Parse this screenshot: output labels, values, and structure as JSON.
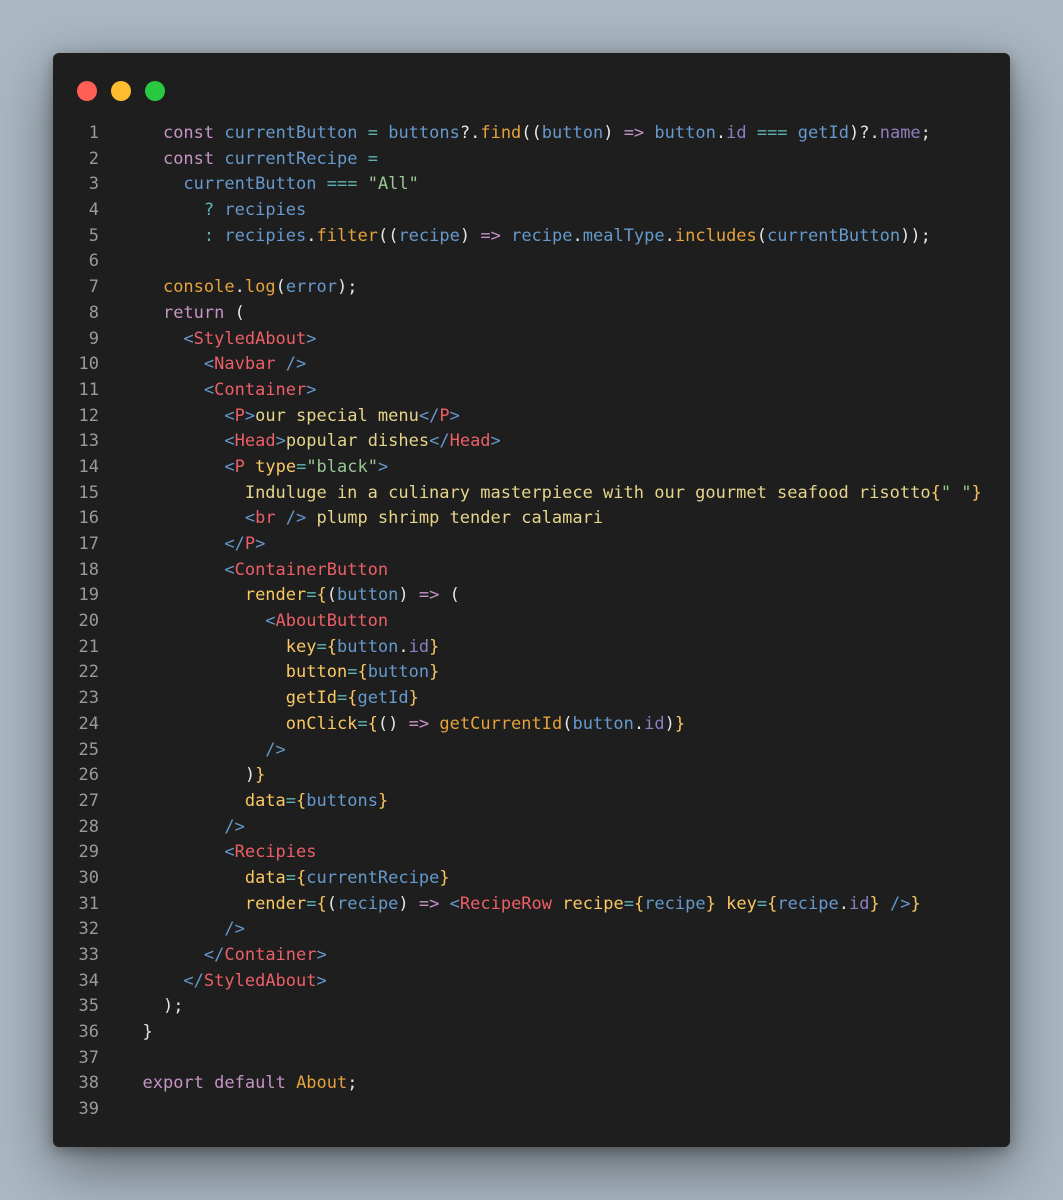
{
  "window": {
    "background": "#1e1e1e",
    "traffic_lights": [
      {
        "name": "close",
        "color": "#ff5f57"
      },
      {
        "name": "minimize",
        "color": "#febc2e"
      },
      {
        "name": "zoom",
        "color": "#28c840"
      }
    ]
  },
  "palette": {
    "k": "#c594c5",
    "v": "#6699cc",
    "f": "#e5a23c",
    "t": "#ec5f67",
    "a": "#fac863",
    "s": "#99c794",
    "o": "#5fb3b3",
    "x": "#e5d48a",
    "p": "#e5e5e5",
    "i": "#8f7ebd"
  },
  "code": {
    "lines": [
      {
        "n": "1",
        "tokens": [
          [
            "    ",
            "p"
          ],
          [
            "const",
            "k"
          ],
          [
            " ",
            "p"
          ],
          [
            "currentButton",
            "v"
          ],
          [
            " ",
            "p"
          ],
          [
            "=",
            "o"
          ],
          [
            " ",
            "p"
          ],
          [
            "buttons",
            "v"
          ],
          [
            "?.",
            "p"
          ],
          [
            "find",
            "f"
          ],
          [
            "((",
            "p"
          ],
          [
            "button",
            "v"
          ],
          [
            ") ",
            "p"
          ],
          [
            "=>",
            "k"
          ],
          [
            " ",
            "p"
          ],
          [
            "button",
            "v"
          ],
          [
            ".",
            "p"
          ],
          [
            "id",
            "i"
          ],
          [
            " ",
            "p"
          ],
          [
            "===",
            "o"
          ],
          [
            " ",
            "p"
          ],
          [
            "getId",
            "v"
          ],
          [
            ")",
            "p"
          ],
          [
            "?.",
            "p"
          ],
          [
            "name",
            "i"
          ],
          [
            ";",
            "p"
          ]
        ]
      },
      {
        "n": "2",
        "tokens": [
          [
            "    ",
            "p"
          ],
          [
            "const",
            "k"
          ],
          [
            " ",
            "p"
          ],
          [
            "currentRecipe",
            "v"
          ],
          [
            " ",
            "p"
          ],
          [
            "=",
            "o"
          ]
        ]
      },
      {
        "n": "3",
        "tokens": [
          [
            "      ",
            "p"
          ],
          [
            "currentButton",
            "v"
          ],
          [
            " ",
            "p"
          ],
          [
            "===",
            "o"
          ],
          [
            " ",
            "p"
          ],
          [
            "\"All\"",
            "s"
          ]
        ]
      },
      {
        "n": "4",
        "tokens": [
          [
            "        ",
            "p"
          ],
          [
            "?",
            "o"
          ],
          [
            " ",
            "p"
          ],
          [
            "recipies",
            "v"
          ]
        ]
      },
      {
        "n": "5",
        "tokens": [
          [
            "        ",
            "p"
          ],
          [
            ":",
            "o"
          ],
          [
            " ",
            "p"
          ],
          [
            "recipies",
            "v"
          ],
          [
            ".",
            "p"
          ],
          [
            "filter",
            "f"
          ],
          [
            "((",
            "p"
          ],
          [
            "recipe",
            "v"
          ],
          [
            ") ",
            "p"
          ],
          [
            "=>",
            "k"
          ],
          [
            " ",
            "p"
          ],
          [
            "recipe",
            "v"
          ],
          [
            ".",
            "p"
          ],
          [
            "mealType",
            "v"
          ],
          [
            ".",
            "p"
          ],
          [
            "includes",
            "f"
          ],
          [
            "(",
            "p"
          ],
          [
            "currentButton",
            "v"
          ],
          [
            "));",
            "p"
          ]
        ]
      },
      {
        "n": "6",
        "tokens": []
      },
      {
        "n": "7",
        "tokens": [
          [
            "    ",
            "p"
          ],
          [
            "console",
            "f"
          ],
          [
            ".",
            "p"
          ],
          [
            "log",
            "f"
          ],
          [
            "(",
            "p"
          ],
          [
            "error",
            "v"
          ],
          [
            ");",
            "p"
          ]
        ]
      },
      {
        "n": "8",
        "tokens": [
          [
            "    ",
            "p"
          ],
          [
            "return",
            "k"
          ],
          [
            " (",
            "p"
          ]
        ]
      },
      {
        "n": "9",
        "tokens": [
          [
            "      ",
            "p"
          ],
          [
            "<",
            "v"
          ],
          [
            "StyledAbout",
            "t"
          ],
          [
            ">",
            "v"
          ]
        ]
      },
      {
        "n": "10",
        "tokens": [
          [
            "        ",
            "p"
          ],
          [
            "<",
            "v"
          ],
          [
            "Navbar",
            "t"
          ],
          [
            " />",
            "v"
          ]
        ]
      },
      {
        "n": "11",
        "tokens": [
          [
            "        ",
            "p"
          ],
          [
            "<",
            "v"
          ],
          [
            "Container",
            "t"
          ],
          [
            ">",
            "v"
          ]
        ]
      },
      {
        "n": "12",
        "tokens": [
          [
            "          ",
            "p"
          ],
          [
            "<",
            "v"
          ],
          [
            "P",
            "t"
          ],
          [
            ">",
            "v"
          ],
          [
            "our special menu",
            "x"
          ],
          [
            "</",
            "v"
          ],
          [
            "P",
            "t"
          ],
          [
            ">",
            "v"
          ]
        ]
      },
      {
        "n": "13",
        "tokens": [
          [
            "          ",
            "p"
          ],
          [
            "<",
            "v"
          ],
          [
            "Head",
            "t"
          ],
          [
            ">",
            "v"
          ],
          [
            "popular dishes",
            "x"
          ],
          [
            "</",
            "v"
          ],
          [
            "Head",
            "t"
          ],
          [
            ">",
            "v"
          ]
        ]
      },
      {
        "n": "14",
        "tokens": [
          [
            "          ",
            "p"
          ],
          [
            "<",
            "v"
          ],
          [
            "P",
            "t"
          ],
          [
            " ",
            "p"
          ],
          [
            "type",
            "a"
          ],
          [
            "=",
            "o"
          ],
          [
            "\"black\"",
            "s"
          ],
          [
            ">",
            "v"
          ]
        ]
      },
      {
        "n": "15",
        "tokens": [
          [
            "            ",
            "p"
          ],
          [
            "Induluge in a culinary masterpiece with our gourmet seafood risotto",
            "x"
          ],
          [
            "{",
            "a"
          ],
          [
            "\" \"",
            "s"
          ],
          [
            "}",
            "a"
          ]
        ]
      },
      {
        "n": "16",
        "tokens": [
          [
            "            ",
            "p"
          ],
          [
            "<",
            "v"
          ],
          [
            "br",
            "t"
          ],
          [
            " />",
            "v"
          ],
          [
            " plump shrimp tender calamari",
            "x"
          ]
        ]
      },
      {
        "n": "17",
        "tokens": [
          [
            "          ",
            "p"
          ],
          [
            "</",
            "v"
          ],
          [
            "P",
            "t"
          ],
          [
            ">",
            "v"
          ]
        ]
      },
      {
        "n": "18",
        "tokens": [
          [
            "          ",
            "p"
          ],
          [
            "<",
            "v"
          ],
          [
            "ContainerButton",
            "t"
          ]
        ]
      },
      {
        "n": "19",
        "tokens": [
          [
            "            ",
            "p"
          ],
          [
            "render",
            "a"
          ],
          [
            "=",
            "o"
          ],
          [
            "{",
            "a"
          ],
          [
            "(",
            "p"
          ],
          [
            "button",
            "v"
          ],
          [
            ") ",
            "p"
          ],
          [
            "=>",
            "k"
          ],
          [
            " (",
            "p"
          ]
        ]
      },
      {
        "n": "20",
        "tokens": [
          [
            "              ",
            "p"
          ],
          [
            "<",
            "v"
          ],
          [
            "AboutButton",
            "t"
          ]
        ]
      },
      {
        "n": "21",
        "tokens": [
          [
            "                ",
            "p"
          ],
          [
            "key",
            "a"
          ],
          [
            "=",
            "o"
          ],
          [
            "{",
            "a"
          ],
          [
            "button",
            "v"
          ],
          [
            ".",
            "p"
          ],
          [
            "id",
            "i"
          ],
          [
            "}",
            "a"
          ]
        ]
      },
      {
        "n": "22",
        "tokens": [
          [
            "                ",
            "p"
          ],
          [
            "button",
            "a"
          ],
          [
            "=",
            "o"
          ],
          [
            "{",
            "a"
          ],
          [
            "button",
            "v"
          ],
          [
            "}",
            "a"
          ]
        ]
      },
      {
        "n": "23",
        "tokens": [
          [
            "                ",
            "p"
          ],
          [
            "getId",
            "a"
          ],
          [
            "=",
            "o"
          ],
          [
            "{",
            "a"
          ],
          [
            "getId",
            "v"
          ],
          [
            "}",
            "a"
          ]
        ]
      },
      {
        "n": "24",
        "tokens": [
          [
            "                ",
            "p"
          ],
          [
            "onClick",
            "a"
          ],
          [
            "=",
            "o"
          ],
          [
            "{",
            "a"
          ],
          [
            "() ",
            "p"
          ],
          [
            "=>",
            "k"
          ],
          [
            " ",
            "p"
          ],
          [
            "getCurrentId",
            "f"
          ],
          [
            "(",
            "p"
          ],
          [
            "button",
            "v"
          ],
          [
            ".",
            "p"
          ],
          [
            "id",
            "i"
          ],
          [
            ")",
            "p"
          ],
          [
            "}",
            "a"
          ]
        ]
      },
      {
        "n": "25",
        "tokens": [
          [
            "              ",
            "p"
          ],
          [
            "/>",
            "v"
          ]
        ]
      },
      {
        "n": "26",
        "tokens": [
          [
            "            ",
            "p"
          ],
          [
            ")",
            "p"
          ],
          [
            "}",
            "a"
          ]
        ]
      },
      {
        "n": "27",
        "tokens": [
          [
            "            ",
            "p"
          ],
          [
            "data",
            "a"
          ],
          [
            "=",
            "o"
          ],
          [
            "{",
            "a"
          ],
          [
            "buttons",
            "v"
          ],
          [
            "}",
            "a"
          ]
        ]
      },
      {
        "n": "28",
        "tokens": [
          [
            "          ",
            "p"
          ],
          [
            "/>",
            "v"
          ]
        ]
      },
      {
        "n": "29",
        "tokens": [
          [
            "          ",
            "p"
          ],
          [
            "<",
            "v"
          ],
          [
            "Recipies",
            "t"
          ]
        ]
      },
      {
        "n": "30",
        "tokens": [
          [
            "            ",
            "p"
          ],
          [
            "data",
            "a"
          ],
          [
            "=",
            "o"
          ],
          [
            "{",
            "a"
          ],
          [
            "currentRecipe",
            "v"
          ],
          [
            "}",
            "a"
          ]
        ]
      },
      {
        "n": "31",
        "tokens": [
          [
            "            ",
            "p"
          ],
          [
            "render",
            "a"
          ],
          [
            "=",
            "o"
          ],
          [
            "{",
            "a"
          ],
          [
            "(",
            "p"
          ],
          [
            "recipe",
            "v"
          ],
          [
            ") ",
            "p"
          ],
          [
            "=>",
            "k"
          ],
          [
            " ",
            "p"
          ],
          [
            "<",
            "v"
          ],
          [
            "RecipeRow",
            "t"
          ],
          [
            " ",
            "p"
          ],
          [
            "recipe",
            "a"
          ],
          [
            "=",
            "o"
          ],
          [
            "{",
            "a"
          ],
          [
            "recipe",
            "v"
          ],
          [
            "}",
            "a"
          ],
          [
            " ",
            "p"
          ],
          [
            "key",
            "a"
          ],
          [
            "=",
            "o"
          ],
          [
            "{",
            "a"
          ],
          [
            "recipe",
            "v"
          ],
          [
            ".",
            "p"
          ],
          [
            "id",
            "i"
          ],
          [
            "}",
            "a"
          ],
          [
            " />",
            "v"
          ],
          [
            "}",
            "a"
          ]
        ]
      },
      {
        "n": "32",
        "tokens": [
          [
            "          ",
            "p"
          ],
          [
            "/>",
            "v"
          ]
        ]
      },
      {
        "n": "33",
        "tokens": [
          [
            "        ",
            "p"
          ],
          [
            "</",
            "v"
          ],
          [
            "Container",
            "t"
          ],
          [
            ">",
            "v"
          ]
        ]
      },
      {
        "n": "34",
        "tokens": [
          [
            "      ",
            "p"
          ],
          [
            "</",
            "v"
          ],
          [
            "StyledAbout",
            "t"
          ],
          [
            ">",
            "v"
          ]
        ]
      },
      {
        "n": "35",
        "tokens": [
          [
            "    ",
            "p"
          ],
          [
            ");",
            "p"
          ]
        ]
      },
      {
        "n": "36",
        "tokens": [
          [
            "  ",
            "p"
          ],
          [
            "}",
            "p"
          ]
        ]
      },
      {
        "n": "37",
        "tokens": []
      },
      {
        "n": "38",
        "tokens": [
          [
            "  ",
            "p"
          ],
          [
            "export",
            "k"
          ],
          [
            " ",
            "p"
          ],
          [
            "default",
            "k"
          ],
          [
            " ",
            "p"
          ],
          [
            "About",
            "f"
          ],
          [
            ";",
            "p"
          ]
        ]
      },
      {
        "n": "39",
        "tokens": []
      }
    ]
  }
}
